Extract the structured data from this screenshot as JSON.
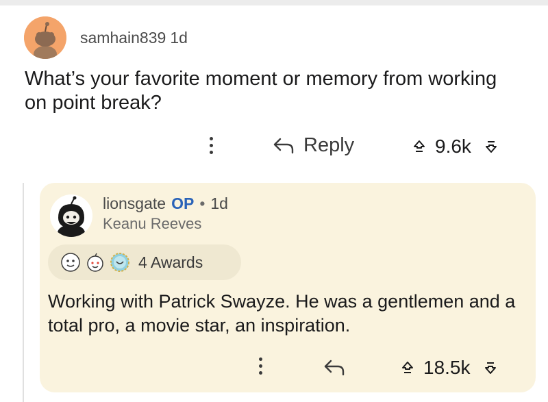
{
  "top_comment": {
    "username": "samhain839",
    "time": "1d",
    "body": "What’s your favorite moment or memory from working on point break?",
    "reply_label": "Reply",
    "score": "9.6k"
  },
  "reply_comment": {
    "username": "lionsgate",
    "op_badge": "OP",
    "separator": "•",
    "time": "1d",
    "flair": "Keanu Reeves",
    "awards_label": "4 Awards",
    "body": "Working with Patrick Swayze. He was a gentlemen and a total pro, a movie star, an inspiration.",
    "score": "18.5k"
  },
  "colors": {
    "avatar_bg": "#f4a46a",
    "card_bg": "#faf3de",
    "op_color": "#2a63b8"
  }
}
